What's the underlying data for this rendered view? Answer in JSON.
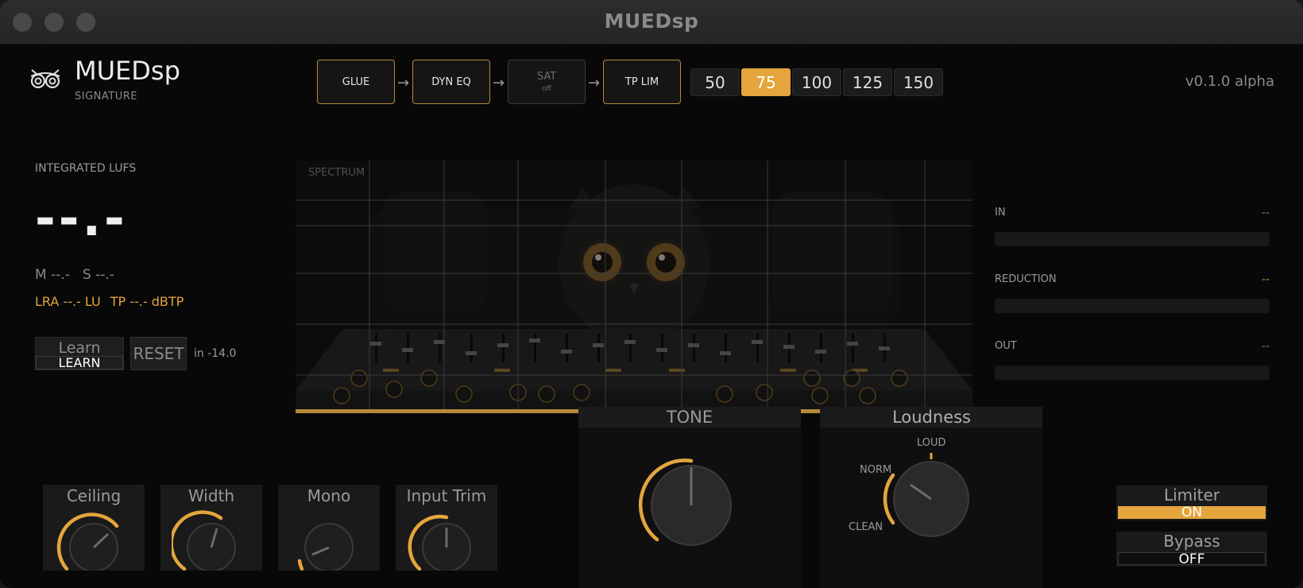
{
  "window": {
    "title": "MUEDsp"
  },
  "header": {
    "brand": "MUEDsp",
    "brand_sub": "SIGNATURE",
    "version": "v0.1.0 alpha"
  },
  "chain": [
    {
      "label": "GLUE",
      "sub": "",
      "state": "on"
    },
    {
      "label": "DYN EQ",
      "sub": "",
      "state": "on"
    },
    {
      "label": "SAT",
      "sub": "off",
      "state": "off"
    },
    {
      "label": "TP LIM",
      "sub": "",
      "state": "on"
    }
  ],
  "ceiling_options": [
    "50",
    "75",
    "100",
    "125",
    "150"
  ],
  "ceiling_selected": "75",
  "lufs": {
    "title": "INTEGRATED LUFS",
    "value": "--.-",
    "momentary": "M --.-",
    "short_term": "S --.-",
    "lra": "LRA --.- LU",
    "tp": "TP --.- dBTP"
  },
  "learn": {
    "label": "Learn",
    "button": "LEARN",
    "reset": "RESET",
    "target": "in -14.0"
  },
  "spectrum": {
    "label": "SPECTRUM"
  },
  "meters": [
    {
      "label": "IN",
      "value": "--"
    },
    {
      "label": "REDUCTION",
      "value": "--"
    },
    {
      "label": "OUT",
      "value": "--"
    }
  ],
  "tone": {
    "label": "TONE"
  },
  "loudness": {
    "label": "Loudness",
    "loud": "LOUD",
    "norm": "NORM",
    "clean": "CLEAN"
  },
  "knobs": [
    {
      "label": "Ceiling"
    },
    {
      "label": "Width"
    },
    {
      "label": "Mono"
    },
    {
      "label": "Input Trim"
    }
  ],
  "limiter": {
    "label": "Limiter",
    "state": "ON"
  },
  "bypass": {
    "label": "Bypass",
    "state": "OFF"
  },
  "colors": {
    "accent": "#e4a53d",
    "accent_dim": "#b5893a",
    "panel": "#1a1a1a"
  }
}
